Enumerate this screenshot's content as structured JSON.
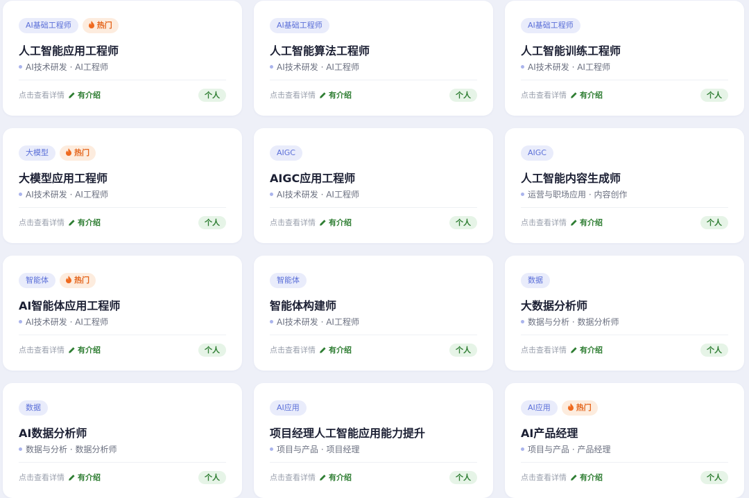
{
  "cards": [
    {
      "tag": "AI基础工程师",
      "hot": "热门",
      "title": "人工智能应用工程师",
      "subtitle": "AI技术研发 · AI工程师",
      "view_label": "点击查看详情",
      "intro_label": "有介绍",
      "badge": "个人"
    },
    {
      "tag": "AI基础工程师",
      "hot": "",
      "title": "人工智能算法工程师",
      "subtitle": "AI技术研发 · AI工程师",
      "view_label": "点击查看详情",
      "intro_label": "有介绍",
      "badge": "个人"
    },
    {
      "tag": "AI基础工程师",
      "hot": "",
      "title": "人工智能训练工程师",
      "subtitle": "AI技术研发 · AI工程师",
      "view_label": "点击查看详情",
      "intro_label": "有介绍",
      "badge": "个人"
    },
    {
      "tag": "大模型",
      "hot": "热门",
      "title": "大模型应用工程师",
      "subtitle": "AI技术研发 · AI工程师",
      "view_label": "点击查看详情",
      "intro_label": "有介绍",
      "badge": "个人"
    },
    {
      "tag": "AIGC",
      "hot": "",
      "title": "AIGC应用工程师",
      "subtitle": "AI技术研发 · AI工程师",
      "view_label": "点击查看详情",
      "intro_label": "有介绍",
      "badge": "个人"
    },
    {
      "tag": "AIGC",
      "hot": "",
      "title": "人工智能内容生成师",
      "subtitle": "运营与职场应用 · 内容创作",
      "view_label": "点击查看详情",
      "intro_label": "有介绍",
      "badge": "个人"
    },
    {
      "tag": "智能体",
      "hot": "热门",
      "title": "AI智能体应用工程师",
      "subtitle": "AI技术研发 · AI工程师",
      "view_label": "点击查看详情",
      "intro_label": "有介绍",
      "badge": "个人"
    },
    {
      "tag": "智能体",
      "hot": "",
      "title": "智能体构建师",
      "subtitle": "AI技术研发 · AI工程师",
      "view_label": "点击查看详情",
      "intro_label": "有介绍",
      "badge": "个人"
    },
    {
      "tag": "数据",
      "hot": "",
      "title": "大数据分析师",
      "subtitle": "数据与分析 · 数据分析师",
      "view_label": "点击查看详情",
      "intro_label": "有介绍",
      "badge": "个人"
    },
    {
      "tag": "数据",
      "hot": "",
      "title": "AI数据分析师",
      "subtitle": "数据与分析 · 数据分析师",
      "view_label": "点击查看详情",
      "intro_label": "有介绍",
      "badge": "个人"
    },
    {
      "tag": "AI应用",
      "hot": "",
      "title": "项目经理人工智能应用能力提升",
      "subtitle": "项目与产品 · 项目经理",
      "view_label": "点击查看详情",
      "intro_label": "有介绍",
      "badge": "个人"
    },
    {
      "tag": "AI应用",
      "hot": "热门",
      "title": "AI产品经理",
      "subtitle": "项目与产品 · 产品经理",
      "view_label": "点击查看详情",
      "intro_label": "有介绍",
      "badge": "个人"
    }
  ],
  "icons": {
    "hot": "flame-icon",
    "intro": "pencil-icon",
    "subtitle": "dot-icon"
  },
  "colors": {
    "accent": "#5b6fd8",
    "hot": "#e4651c",
    "success": "#2e7d32"
  }
}
